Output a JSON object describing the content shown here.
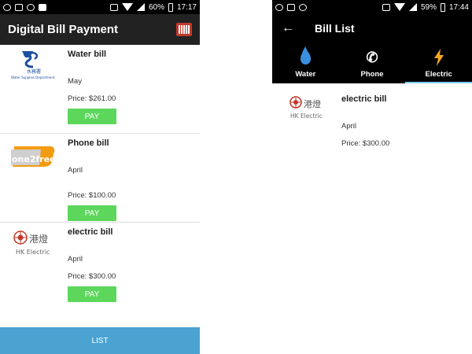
{
  "left": {
    "status": {
      "battery": "60%",
      "time": "17:17"
    },
    "appbar": {
      "title": "Digital Bill Payment",
      "action_icon": "barcode-icon"
    },
    "bills": [
      {
        "name": "Water bill",
        "month": "May",
        "price": "Price: $261.00",
        "pay_label": "PAY",
        "logo": "water-supplies-logo",
        "logo_text": "水務署",
        "logo_sub": "Water Supplies Department"
      },
      {
        "name": "Phone bill",
        "month": "April",
        "price": "Price: $100.00",
        "pay_label": "PAY",
        "logo": "one2free-logo",
        "logo_text": "one2free"
      },
      {
        "name": "electric bill",
        "month": "April",
        "price": "Price: $300.00",
        "pay_label": "PAY",
        "logo": "hk-electric-logo",
        "logo_text": "港燈",
        "logo_sub": "HK Electric"
      }
    ],
    "list_label": "LIST"
  },
  "right": {
    "status": {
      "battery": "59%",
      "time": "17:44"
    },
    "appbar": {
      "title": "Bill List"
    },
    "tabs": [
      {
        "label": "Water",
        "icon": "water-drop-icon"
      },
      {
        "label": "Phone",
        "icon": "phone-icon"
      },
      {
        "label": "Electric",
        "icon": "lightning-icon",
        "active": true
      }
    ],
    "bills": [
      {
        "name": "electric bill",
        "month": "April",
        "price": "Price: $300.00",
        "logo": "hk-electric-logo",
        "logo_text": "港燈",
        "logo_sub": "HK Electric"
      }
    ]
  },
  "colors": {
    "pay": "#5cd75c",
    "list": "#4aa3d1",
    "appbar": "#222222",
    "tab_indicator": "#7fd0ff",
    "one2free_orange": "#f39c12"
  }
}
